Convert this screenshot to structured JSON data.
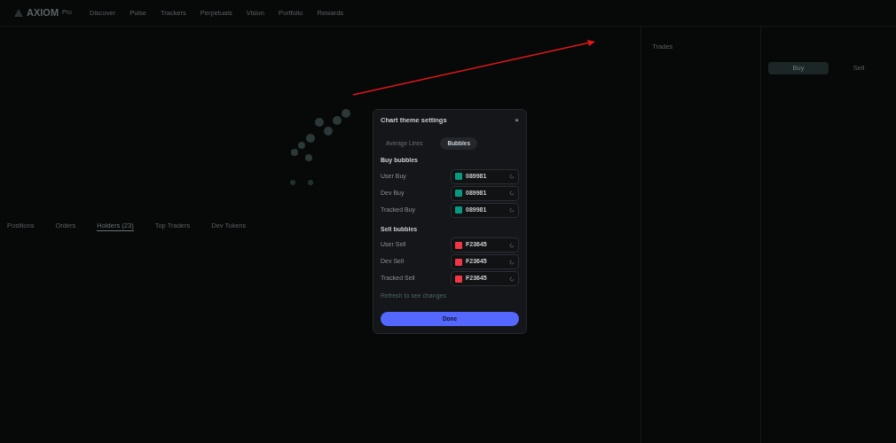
{
  "nav": {
    "logo": "AXIOM",
    "badge": "Pro",
    "items": [
      "Discover",
      "Pulse",
      "Trackers",
      "Perpetuals",
      "Vision",
      "Portfolio",
      "Rewards"
    ]
  },
  "bottom_tabs": [
    {
      "label": "Positions",
      "selected": false
    },
    {
      "label": "Orders",
      "selected": false
    },
    {
      "label": "Holders (23)",
      "selected": true
    },
    {
      "label": "Top Traders",
      "selected": false
    },
    {
      "label": "Dev Tokens",
      "selected": false
    }
  ],
  "trades": {
    "title": "Trades"
  },
  "trade_panel": {
    "tabs": [
      {
        "label": "Buy",
        "selected": true
      },
      {
        "label": "Sell",
        "selected": false
      }
    ]
  },
  "dialog": {
    "title": "Chart theme settings",
    "close": "×",
    "tabs": [
      {
        "label": "Average Lines",
        "selected": false
      },
      {
        "label": "Bubbles",
        "selected": true
      }
    ],
    "sections": [
      {
        "title": "Buy bubbles",
        "rows": [
          {
            "label": "User Buy",
            "color": "#089981",
            "value": "089981"
          },
          {
            "label": "Dev Buy",
            "color": "#089981",
            "value": "089981"
          },
          {
            "label": "Tracked Buy",
            "color": "#089981",
            "value": "089981"
          }
        ]
      },
      {
        "title": "Sell bubbles",
        "rows": [
          {
            "label": "User Sell",
            "color": "#f23645",
            "value": "F23645"
          },
          {
            "label": "Dev Sell",
            "color": "#f23645",
            "value": "F23645"
          },
          {
            "label": "Tracked Sell",
            "color": "#f23645",
            "value": "F23645"
          }
        ]
      }
    ],
    "hint": "Refresh to see changes",
    "done": "Done"
  }
}
